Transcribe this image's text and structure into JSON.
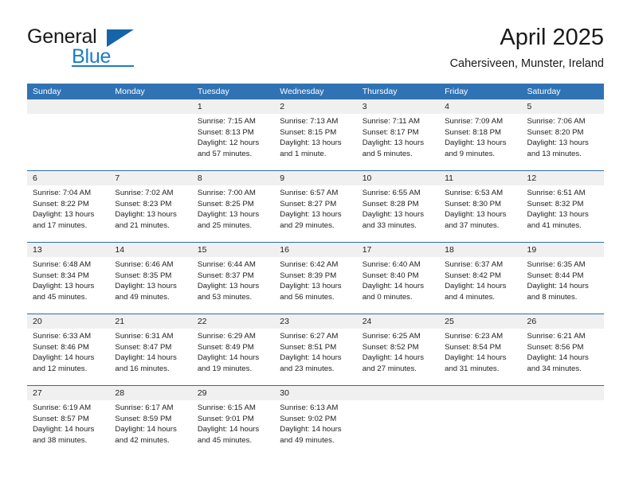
{
  "brand": {
    "word_one": "General",
    "word_two": "Blue",
    "logo_icon": "triangle-logo-icon"
  },
  "header": {
    "title": "April 2025",
    "location": "Cahersiveen, Munster, Ireland"
  },
  "colors": {
    "header_blue": "#3073b4",
    "separator_blue": "#2e6da4",
    "number_band": "#f0f0f0",
    "brand_blue": "#1d7cc4",
    "text": "#222222"
  },
  "weekdays": [
    "Sunday",
    "Monday",
    "Tuesday",
    "Wednesday",
    "Thursday",
    "Friday",
    "Saturday"
  ],
  "weeks": [
    [
      {
        "day": "",
        "l1": "",
        "l2": "",
        "l3": "",
        "l4": ""
      },
      {
        "day": "",
        "l1": "",
        "l2": "",
        "l3": "",
        "l4": ""
      },
      {
        "day": "1",
        "l1": "Sunrise: 7:15 AM",
        "l2": "Sunset: 8:13 PM",
        "l3": "Daylight: 12 hours",
        "l4": "and 57 minutes."
      },
      {
        "day": "2",
        "l1": "Sunrise: 7:13 AM",
        "l2": "Sunset: 8:15 PM",
        "l3": "Daylight: 13 hours",
        "l4": "and 1 minute."
      },
      {
        "day": "3",
        "l1": "Sunrise: 7:11 AM",
        "l2": "Sunset: 8:17 PM",
        "l3": "Daylight: 13 hours",
        "l4": "and 5 minutes."
      },
      {
        "day": "4",
        "l1": "Sunrise: 7:09 AM",
        "l2": "Sunset: 8:18 PM",
        "l3": "Daylight: 13 hours",
        "l4": "and 9 minutes."
      },
      {
        "day": "5",
        "l1": "Sunrise: 7:06 AM",
        "l2": "Sunset: 8:20 PM",
        "l3": "Daylight: 13 hours",
        "l4": "and 13 minutes."
      }
    ],
    [
      {
        "day": "6",
        "l1": "Sunrise: 7:04 AM",
        "l2": "Sunset: 8:22 PM",
        "l3": "Daylight: 13 hours",
        "l4": "and 17 minutes."
      },
      {
        "day": "7",
        "l1": "Sunrise: 7:02 AM",
        "l2": "Sunset: 8:23 PM",
        "l3": "Daylight: 13 hours",
        "l4": "and 21 minutes."
      },
      {
        "day": "8",
        "l1": "Sunrise: 7:00 AM",
        "l2": "Sunset: 8:25 PM",
        "l3": "Daylight: 13 hours",
        "l4": "and 25 minutes."
      },
      {
        "day": "9",
        "l1": "Sunrise: 6:57 AM",
        "l2": "Sunset: 8:27 PM",
        "l3": "Daylight: 13 hours",
        "l4": "and 29 minutes."
      },
      {
        "day": "10",
        "l1": "Sunrise: 6:55 AM",
        "l2": "Sunset: 8:28 PM",
        "l3": "Daylight: 13 hours",
        "l4": "and 33 minutes."
      },
      {
        "day": "11",
        "l1": "Sunrise: 6:53 AM",
        "l2": "Sunset: 8:30 PM",
        "l3": "Daylight: 13 hours",
        "l4": "and 37 minutes."
      },
      {
        "day": "12",
        "l1": "Sunrise: 6:51 AM",
        "l2": "Sunset: 8:32 PM",
        "l3": "Daylight: 13 hours",
        "l4": "and 41 minutes."
      }
    ],
    [
      {
        "day": "13",
        "l1": "Sunrise: 6:48 AM",
        "l2": "Sunset: 8:34 PM",
        "l3": "Daylight: 13 hours",
        "l4": "and 45 minutes."
      },
      {
        "day": "14",
        "l1": "Sunrise: 6:46 AM",
        "l2": "Sunset: 8:35 PM",
        "l3": "Daylight: 13 hours",
        "l4": "and 49 minutes."
      },
      {
        "day": "15",
        "l1": "Sunrise: 6:44 AM",
        "l2": "Sunset: 8:37 PM",
        "l3": "Daylight: 13 hours",
        "l4": "and 53 minutes."
      },
      {
        "day": "16",
        "l1": "Sunrise: 6:42 AM",
        "l2": "Sunset: 8:39 PM",
        "l3": "Daylight: 13 hours",
        "l4": "and 56 minutes."
      },
      {
        "day": "17",
        "l1": "Sunrise: 6:40 AM",
        "l2": "Sunset: 8:40 PM",
        "l3": "Daylight: 14 hours",
        "l4": "and 0 minutes."
      },
      {
        "day": "18",
        "l1": "Sunrise: 6:37 AM",
        "l2": "Sunset: 8:42 PM",
        "l3": "Daylight: 14 hours",
        "l4": "and 4 minutes."
      },
      {
        "day": "19",
        "l1": "Sunrise: 6:35 AM",
        "l2": "Sunset: 8:44 PM",
        "l3": "Daylight: 14 hours",
        "l4": "and 8 minutes."
      }
    ],
    [
      {
        "day": "20",
        "l1": "Sunrise: 6:33 AM",
        "l2": "Sunset: 8:46 PM",
        "l3": "Daylight: 14 hours",
        "l4": "and 12 minutes."
      },
      {
        "day": "21",
        "l1": "Sunrise: 6:31 AM",
        "l2": "Sunset: 8:47 PM",
        "l3": "Daylight: 14 hours",
        "l4": "and 16 minutes."
      },
      {
        "day": "22",
        "l1": "Sunrise: 6:29 AM",
        "l2": "Sunset: 8:49 PM",
        "l3": "Daylight: 14 hours",
        "l4": "and 19 minutes."
      },
      {
        "day": "23",
        "l1": "Sunrise: 6:27 AM",
        "l2": "Sunset: 8:51 PM",
        "l3": "Daylight: 14 hours",
        "l4": "and 23 minutes."
      },
      {
        "day": "24",
        "l1": "Sunrise: 6:25 AM",
        "l2": "Sunset: 8:52 PM",
        "l3": "Daylight: 14 hours",
        "l4": "and 27 minutes."
      },
      {
        "day": "25",
        "l1": "Sunrise: 6:23 AM",
        "l2": "Sunset: 8:54 PM",
        "l3": "Daylight: 14 hours",
        "l4": "and 31 minutes."
      },
      {
        "day": "26",
        "l1": "Sunrise: 6:21 AM",
        "l2": "Sunset: 8:56 PM",
        "l3": "Daylight: 14 hours",
        "l4": "and 34 minutes."
      }
    ],
    [
      {
        "day": "27",
        "l1": "Sunrise: 6:19 AM",
        "l2": "Sunset: 8:57 PM",
        "l3": "Daylight: 14 hours",
        "l4": "and 38 minutes."
      },
      {
        "day": "28",
        "l1": "Sunrise: 6:17 AM",
        "l2": "Sunset: 8:59 PM",
        "l3": "Daylight: 14 hours",
        "l4": "and 42 minutes."
      },
      {
        "day": "29",
        "l1": "Sunrise: 6:15 AM",
        "l2": "Sunset: 9:01 PM",
        "l3": "Daylight: 14 hours",
        "l4": "and 45 minutes."
      },
      {
        "day": "30",
        "l1": "Sunrise: 6:13 AM",
        "l2": "Sunset: 9:02 PM",
        "l3": "Daylight: 14 hours",
        "l4": "and 49 minutes."
      },
      {
        "day": "",
        "l1": "",
        "l2": "",
        "l3": "",
        "l4": ""
      },
      {
        "day": "",
        "l1": "",
        "l2": "",
        "l3": "",
        "l4": ""
      },
      {
        "day": "",
        "l1": "",
        "l2": "",
        "l3": "",
        "l4": ""
      }
    ]
  ]
}
